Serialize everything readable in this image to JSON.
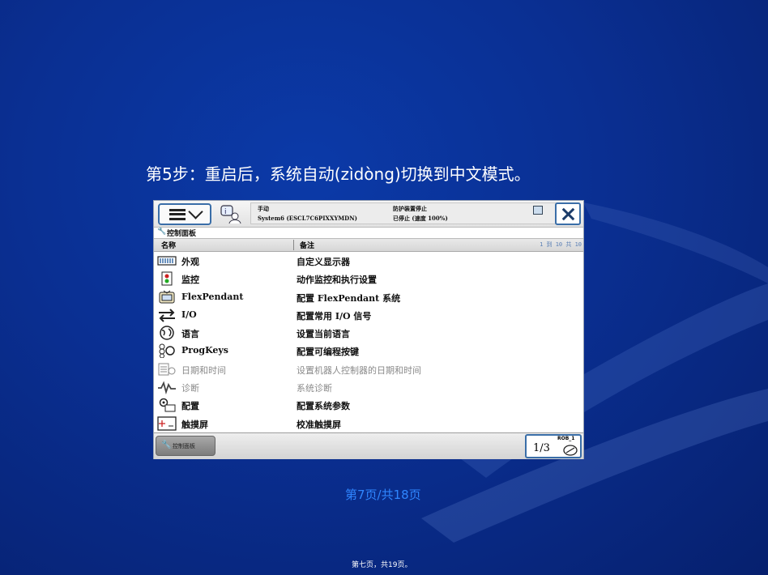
{
  "heading": "第5步：重启后，系统自动(zìdòng)切换到中文模式。",
  "status": {
    "mode": "手动",
    "system": "System6 (ESCL7C6PIXXYMDN)",
    "state": "防护装置停止",
    "speed": "已停止 (速度 100%)"
  },
  "panel_title": "控制面板",
  "columns": {
    "name": "名称",
    "note": "备注",
    "paging": "1 到 10 共 10"
  },
  "rows": [
    {
      "name": "外观",
      "note": "自定义显示器",
      "icon": "appearance-icon",
      "enabled": true
    },
    {
      "name": "监控",
      "note": "动作监控和执行设置",
      "icon": "supervision-icon",
      "enabled": true
    },
    {
      "name": "FlexPendant",
      "note": "配置 FlexPendant 系统",
      "icon": "flexpendant-icon",
      "enabled": true
    },
    {
      "name": "I/O",
      "note": "配置常用 I/O 信号",
      "icon": "io-icon",
      "enabled": true
    },
    {
      "name": "语言",
      "note": "设置当前语言",
      "icon": "language-icon",
      "enabled": true
    },
    {
      "name": "ProgKeys",
      "note": "配置可编程按键",
      "icon": "progkeys-icon",
      "enabled": true
    },
    {
      "name": "日期和时间",
      "note": "设置机器人控制器的日期和时间",
      "icon": "calendar-icon",
      "enabled": false
    },
    {
      "name": "诊断",
      "note": "系统诊断",
      "icon": "diagnostics-icon",
      "enabled": false
    },
    {
      "name": "配置",
      "note": "配置系统参数",
      "icon": "configuration-icon",
      "enabled": true
    },
    {
      "name": "触摸屏",
      "note": "校准触摸屏",
      "icon": "touchscreen-icon",
      "enabled": true
    }
  ],
  "taskbar": {
    "control_panel": "控制面板",
    "rob_label": "ROB_1",
    "fraction": "1/3"
  },
  "footer": {
    "slide_page": "第7页/共18页",
    "doc_page": "第七页，共19页。"
  },
  "colors": {
    "background": "#0a2f92",
    "accent_blue": "#3a6ea8",
    "footer_link": "#2f86ff"
  }
}
